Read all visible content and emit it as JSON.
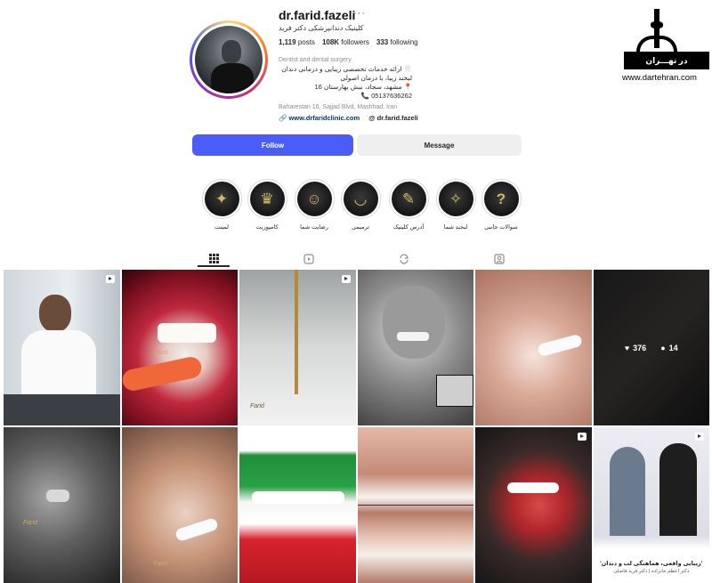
{
  "profile": {
    "username": "dr.farid.fazeli",
    "more_icon": "more-dots-icon",
    "full_name": "کلینیک دندانپزشکی دکتر فرید",
    "posts_count": "1,119",
    "posts_label": "posts",
    "followers_count": "108K",
    "followers_label": "followers",
    "following_count": "333",
    "following_label": "following",
    "category": "Dentist and dental surgery",
    "bio_line_1": "🦷 ارائه خدمات تخصصی زیبایی و درمانی دندان",
    "bio_line_2": "لبخند زیبا، با درمان اصولی",
    "bio_line_3": "📍 مشهد، سجاد، نبش بهارستان 16",
    "bio_line_4": "05137636262 📞",
    "address": "Baharestan 16, Sajjad Blvd, Mashhad, Iran",
    "website": "www.drfaridclinic.com",
    "threads": "dr.farid.fazeli"
  },
  "actions": {
    "follow_label": "Follow",
    "message_label": "Message"
  },
  "highlights": [
    {
      "label": "لمینت",
      "icon": "tooth-veneer-icon",
      "glyph": "✦"
    },
    {
      "label": "کامپوزیت",
      "icon": "tooth-icon",
      "glyph": "♛"
    },
    {
      "label": "رضایت شما",
      "icon": "smile-check-icon",
      "glyph": "☺"
    },
    {
      "label": "ترمیمی",
      "icon": "teeth-icon",
      "glyph": "◡"
    },
    {
      "label": "آدرس کلینیک",
      "icon": "tools-icon",
      "glyph": "✎"
    },
    {
      "label": "لبخند شما",
      "icon": "smile-icon",
      "glyph": "✧"
    },
    {
      "label": "سوالات جانبی",
      "icon": "question-icon",
      "glyph": "?"
    }
  ],
  "watermark": {
    "bar_text": "در تهـــران",
    "url": "www.dartehran.com"
  },
  "tabs": [
    {
      "name": "posts",
      "icon": "grid-icon"
    },
    {
      "name": "reels",
      "icon": "reels-icon"
    },
    {
      "name": "reposts",
      "icon": "repost-icon"
    },
    {
      "name": "tagged",
      "icon": "tagged-icon"
    }
  ],
  "posts": {
    "hover_likes": "376",
    "hover_comments": "14",
    "last_caption": "'زیبایی واقعی، هماهنگی لب و دندان'",
    "last_caption_sub": "دکتر اعظم خانزاده | دکتر فرید فاضلی",
    "signature": "Farid"
  }
}
